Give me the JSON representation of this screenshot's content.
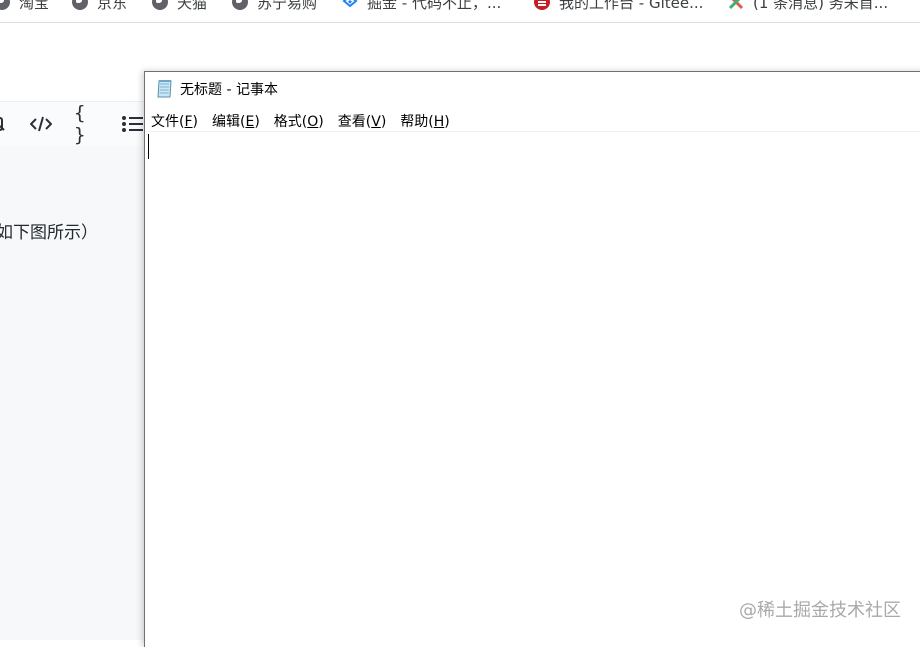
{
  "browser": {
    "bookmarks": [
      {
        "label": "淘宝",
        "icon": "globe-icon"
      },
      {
        "label": "京东",
        "icon": "globe-icon"
      },
      {
        "label": "天猫",
        "icon": "globe-icon"
      },
      {
        "label": "苏宁易购",
        "icon": "globe-icon"
      },
      {
        "label": "掘金 - 代码不止，...",
        "icon": "juejin-logo-icon"
      },
      {
        "label": "我的工作台 - Gitee...",
        "icon": "gitee-logo-icon"
      },
      {
        "label": "(1 条消息) 务未首...",
        "icon": "colorful-x-logo-icon"
      }
    ]
  },
  "background_editor": {
    "toolbar": {
      "icons": [
        "partial-icon",
        "code-tag-icon",
        "braces-icon",
        "list-icon"
      ],
      "braces_label": "{ }"
    },
    "body_text": "如下图所示）"
  },
  "notepad": {
    "title": "无标题 - 记事本",
    "icon": "notepad-icon",
    "menu": [
      {
        "label": "文件(",
        "accel": "F",
        "suffix": ")"
      },
      {
        "label": "编辑(",
        "accel": "E",
        "suffix": ")"
      },
      {
        "label": "格式(",
        "accel": "O",
        "suffix": ")"
      },
      {
        "label": "查看(",
        "accel": "V",
        "suffix": ")"
      },
      {
        "label": "帮助(",
        "accel": "H",
        "suffix": ")"
      }
    ],
    "content": ""
  },
  "watermark": "@稀土掘金技术社区",
  "colors": {
    "window_border": "#707070",
    "editor_bg": "#f6f8fa",
    "text": "#000000"
  }
}
